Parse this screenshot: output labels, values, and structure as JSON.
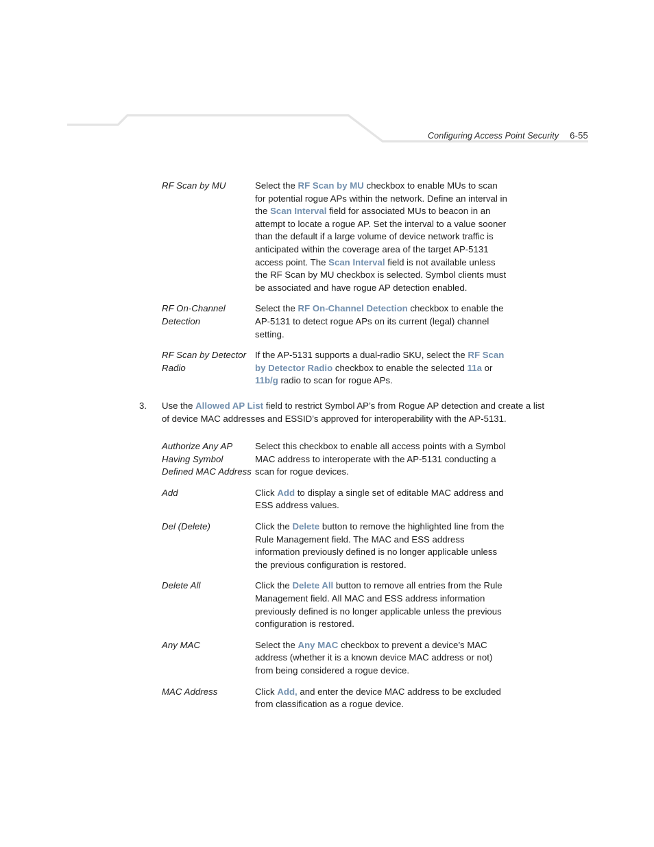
{
  "header": {
    "title": "Configuring Access Point Security",
    "page_number": "6-55",
    "rule_color": "#e4e4e4"
  },
  "accent_color": "#7390ae",
  "text_color": "#1c1c1c",
  "definitions_1": [
    {
      "term": "RF Scan by MU",
      "segments": [
        {
          "t": "Select the ",
          "hl": false
        },
        {
          "t": "RF Scan by MU",
          "hl": true
        },
        {
          "t": " checkbox to enable MUs to scan for potential rogue APs within the network. Define an interval in the ",
          "hl": false
        },
        {
          "t": "Scan Interval",
          "hl": true
        },
        {
          "t": " field for associated MUs to beacon in an attempt to locate a rogue AP. Set the interval to a value sooner than the default if a large volume of device network traffic is anticipated within the coverage area of the target AP-5131 access point. The ",
          "hl": false
        },
        {
          "t": "Scan Interval",
          "hl": true
        },
        {
          "t": " field is not available unless the RF Scan by MU checkbox is selected. Symbol clients must be associated and have rogue AP detection enabled.",
          "hl": false
        }
      ]
    },
    {
      "term": "RF On-Channel Detection",
      "segments": [
        {
          "t": "Select the ",
          "hl": false
        },
        {
          "t": "RF On-Channel Detection",
          "hl": true
        },
        {
          "t": " checkbox to enable the AP-5131 to detect rogue APs on its current (legal) channel setting.",
          "hl": false
        }
      ]
    },
    {
      "term": "RF Scan by Detector Radio",
      "segments": [
        {
          "t": "If the AP-5131 supports a dual-radio SKU, select the ",
          "hl": false
        },
        {
          "t": "RF Scan by Detector Radio",
          "hl": true
        },
        {
          "t": " checkbox to enable the selected ",
          "hl": false
        },
        {
          "t": "11a",
          "hl": true
        },
        {
          "t": " or ",
          "hl": false
        },
        {
          "t": "11b/g",
          "hl": true
        },
        {
          "t": " radio to scan for rogue APs.",
          "hl": false
        }
      ]
    }
  ],
  "step": {
    "number": "3.",
    "segments": [
      {
        "t": "Use the ",
        "hl": false
      },
      {
        "t": "Allowed AP List",
        "hl": true
      },
      {
        "t": " field to restrict Symbol AP’s from Rogue AP detection and create a list of device MAC addresses and ESSID’s approved for interoperability with the AP-5131.",
        "hl": false
      }
    ]
  },
  "definitions_2": [
    {
      "term": "Authorize Any AP Having Symbol Defined MAC Address",
      "segments": [
        {
          "t": "Select this checkbox to enable all access points with a Symbol MAC address to interoperate with the AP-5131 conducting a scan for rogue devices.",
          "hl": false
        }
      ]
    },
    {
      "term": "Add",
      "segments": [
        {
          "t": "Click ",
          "hl": false
        },
        {
          "t": "Add",
          "hl": true
        },
        {
          "t": " to display a single set of editable MAC address and ESS address values.",
          "hl": false
        }
      ]
    },
    {
      "term": "Del (Delete)",
      "segments": [
        {
          "t": "Click the ",
          "hl": false
        },
        {
          "t": "Delete",
          "hl": true
        },
        {
          "t": " button to remove the highlighted line from the Rule Management field. The MAC and ESS address information previously defined is no longer applicable unless the previous configuration is restored.",
          "hl": false
        }
      ]
    },
    {
      "term": "Delete All",
      "segments": [
        {
          "t": "Click the ",
          "hl": false
        },
        {
          "t": "Delete All",
          "hl": true
        },
        {
          "t": " button to remove all entries from the Rule Management field. All MAC and ESS address information previously defined is no longer applicable unless the previous configuration is restored.",
          "hl": false
        }
      ]
    },
    {
      "term": "Any MAC",
      "segments": [
        {
          "t": "Select the ",
          "hl": false
        },
        {
          "t": "Any MAC",
          "hl": true
        },
        {
          "t": " checkbox to prevent a device’s MAC address (whether it is a known device MAC address or not) from being considered a rogue device.",
          "hl": false
        }
      ]
    },
    {
      "term": "MAC Address",
      "segments": [
        {
          "t": "Click ",
          "hl": false
        },
        {
          "t": "Add,",
          "hl": true
        },
        {
          "t": " and enter the device MAC address to be excluded from classification as a rogue device.",
          "hl": false
        }
      ]
    }
  ]
}
